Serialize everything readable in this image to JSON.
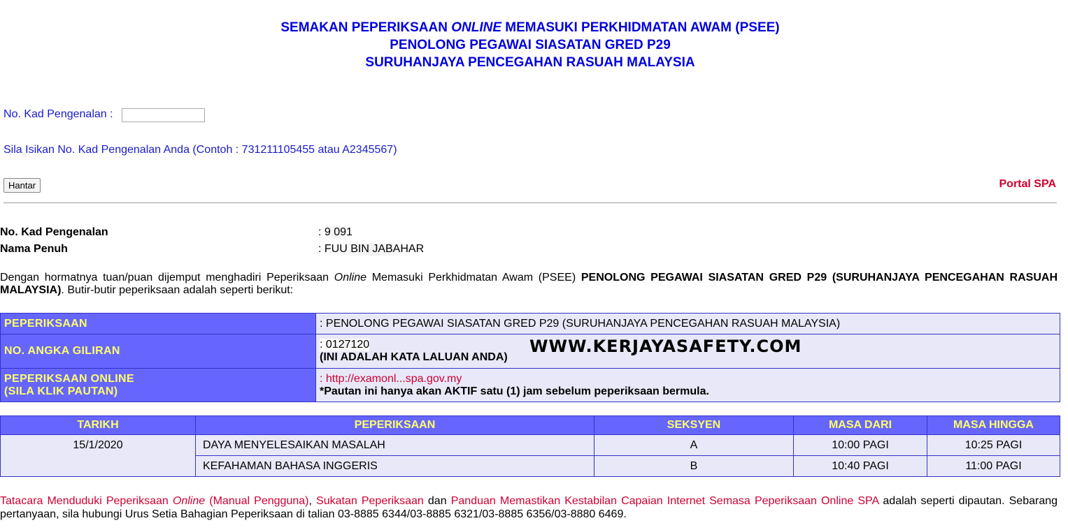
{
  "header": {
    "line1_a": "SEMAKAN PEPERIKSAAN ",
    "line1_em": "ONLINE",
    "line1_b": " MEMASUKI PERKHIDMATAN AWAM (PSEE)",
    "line2": "PENOLONG PEGAWAI SIASATAN GRED P29",
    "line3": "SURUHANJAYA PENCEGAHAN RASUAH MALAYSIA"
  },
  "form": {
    "id_label": "No. Kad Pengenalan :",
    "id_value": "",
    "hint": "Sila Isikan No. Kad Pengenalan Anda (Contoh : 731211105455 atau A2345567)",
    "submit_label": "Hantar",
    "portal_link": "Portal SPA"
  },
  "candidate": {
    "ic_label": "No. Kad Pengenalan",
    "ic_value": ":  9         091",
    "name_label": "Nama Penuh",
    "name_value": ":  FUU BIN JABAHAR"
  },
  "intro": {
    "part1": "Dengan hormatnya tuan/puan dijemput menghadiri Peperiksaan ",
    "part1_em": "Online",
    "part2": " Memasuki Perkhidmatan Awam (PSEE) ",
    "part2_bold": "PENOLONG PEGAWAI SIASATAN GRED P29 (SURUHANJAYA PENCEGAHAN RASUAH MALAYSIA)",
    "part3": ". Butir-butir peperiksaan adalah seperti berikut:"
  },
  "exam_info": {
    "exam_label": "PEPERIKSAAN",
    "exam_value": ": PENOLONG PEGAWAI SIASATAN GRED P29 (SURUHANJAYA PENCEGAHAN RASUAH MALAYSIA)",
    "seat_label": "NO. ANGKA GILIRAN",
    "seat_value": ": 0127120",
    "seat_note": "(INI ADALAH KATA LALUAN ANDA)",
    "online_label_1": "PEPERIKSAAN ONLINE",
    "online_label_2": "(SILA KLIK PAUTAN)",
    "online_link": ": http://examonl...spa.gov.my",
    "online_note": "*Pautan ini hanya akan AKTIF satu (1) jam sebelum peperiksaan bermula."
  },
  "watermark": "WWW.KERJAYASAFETY.COM",
  "schedule": {
    "headers": [
      "TARIKH",
      "PEPERIKSAAN",
      "SEKSYEN",
      "MASA DARI",
      "MASA HINGGA"
    ],
    "date": "15/1/2020",
    "rows": [
      {
        "exam": "DAYA MENYELESAIKAN MASALAH",
        "section": "A",
        "from": "10:00 PAGI",
        "to": "10:25 PAGI"
      },
      {
        "exam": "KEFAHAMAN BAHASA INGGERIS",
        "section": "B",
        "from": "10:40 PAGI",
        "to": "11:00 PAGI"
      }
    ]
  },
  "footer": {
    "link1": "Tatacara Menduduki Peperiksaan ",
    "link1_em": "Online",
    "link1_b": " (Manual Pengguna)",
    "sep1": ", ",
    "link2": "Sukatan Peperiksaan",
    "sep2": " dan ",
    "link3": "Panduan Memastikan Kestabilan Capaian Internet Semasa Peperiksaan Online SPA",
    "rest": " adalah seperti dipautan. Sebarang pertanyaan, sila hubungi Urus Setia Bahagian Peperiksaan di talian 03-8885 6344/03-8885 6321/03-8885 6356/03-8880 6469."
  },
  "colors": {
    "header_blue": "#0000dd",
    "table_header_bg": "#6666ff",
    "table_header_text": "#ffff66",
    "table_cell_bg": "#e8e8f8",
    "link_red": "#cc0033"
  }
}
